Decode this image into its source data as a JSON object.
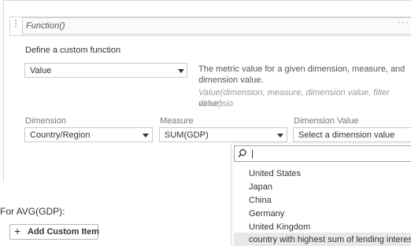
{
  "function_bar": {
    "grip_icon": "drag-handle-icon",
    "value": "Function()",
    "more_icon": "ellipsis-icon"
  },
  "section_title": "Define a custom function",
  "function_select": {
    "value": "Value"
  },
  "description": {
    "line1": "The metric value for a given dimension, measure, and",
    "line2": "dimension value.",
    "syntax_line1": "Value(dimension, measure, dimension value, filter dimensio",
    "syntax_line2": "value)"
  },
  "labels": {
    "dimension": "Dimension",
    "measure": "Measure",
    "dimension_value": "Dimension Value"
  },
  "dimension_select": {
    "value": "Country/Region"
  },
  "measure_select": {
    "value": "SUM(GDP)"
  },
  "dimension_value_select": {
    "placeholder": "Select a dimension value"
  },
  "dropdown": {
    "search_icon": "search-icon",
    "search_value": "|",
    "options": [
      "United States",
      "Japan",
      "China",
      "Germany",
      "United Kingdom",
      "country with highest sum of lending interest"
    ],
    "highlighted_index": 5
  },
  "for_label": "For AVG(GDP):",
  "add_button": {
    "icon": "plus-icon",
    "label": "Add Custom Item"
  }
}
